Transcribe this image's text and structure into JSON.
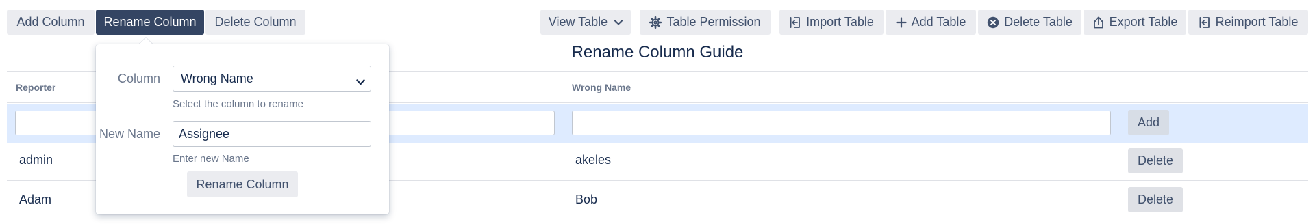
{
  "toolbar": {
    "add_column": "Add Column",
    "rename_column": "Rename Column",
    "delete_column": "Delete Column",
    "view_table": "View Table",
    "table_permission": "Table Permission",
    "import_table": "Import Table",
    "add_table": "Add Table",
    "delete_table": "Delete Table",
    "export_table": "Export Table",
    "reimport_table": "Reimport Table"
  },
  "page": {
    "title": "Rename Column Guide"
  },
  "table": {
    "headers": [
      "Reporter",
      "",
      "Wrong Name"
    ],
    "add_button": "Add",
    "rows": [
      {
        "reporter": "admin",
        "wrong_name": "akeles",
        "action": "Delete"
      },
      {
        "reporter": "Adam",
        "wrong_name": "Bob",
        "action": "Delete"
      }
    ]
  },
  "popup": {
    "column_label": "Column",
    "column_value": "Wrong Name",
    "column_help": "Select the column to rename",
    "new_name_label": "New Name",
    "new_name_value": "Assignee",
    "new_name_help": "Enter new Name",
    "submit": "Rename Column"
  },
  "colors": {
    "active_button": "#344563",
    "button_bg": "#ebecf0",
    "input_row_bg": "#deebff",
    "text": "#172b4d",
    "muted": "#6b778c"
  }
}
